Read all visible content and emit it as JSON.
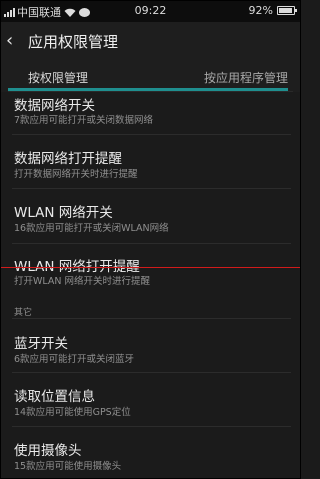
{
  "status_bar": {
    "carrier": "中国联通",
    "time": "09:22",
    "battery": "92%",
    "battery_level": 0.92,
    "icons": [
      "signal-icon",
      "wifi-icon",
      "chat-icon",
      "battery-icon"
    ]
  },
  "header": {
    "back_icon": "‹",
    "title": "应用权限管理"
  },
  "tabs": [
    {
      "label": "按权限管理",
      "selected": true
    },
    {
      "label": "按应用程序管理",
      "selected": false
    }
  ],
  "items": [
    {
      "title": "数据网络开关",
      "subtitle": "7款应用可能打开或关闭数据网络"
    },
    {
      "title": "数据网络打开提醒",
      "subtitle": "打开数据网络开关时进行提醒"
    },
    {
      "title": "WLAN 网络开关",
      "subtitle": "16款应用可能打开或关闭WLAN网络"
    },
    {
      "title": "WLAN 网络打开提醒",
      "subtitle": "打开WLAN 网络开关时进行提醒"
    }
  ],
  "section_label": "其它",
  "other_items": [
    {
      "title": "蓝牙开关",
      "subtitle": "6款应用可能打开或关闭蓝牙"
    },
    {
      "title": "读取位置信息",
      "subtitle": "14款应用可能使用GPS定位"
    },
    {
      "title": "使用摄像头",
      "subtitle": "15款应用可能使用摄像头"
    }
  ],
  "colors": {
    "background": "#1b1b1b",
    "accent": "#1f8f8f",
    "marker_line": "#d21b1b"
  }
}
